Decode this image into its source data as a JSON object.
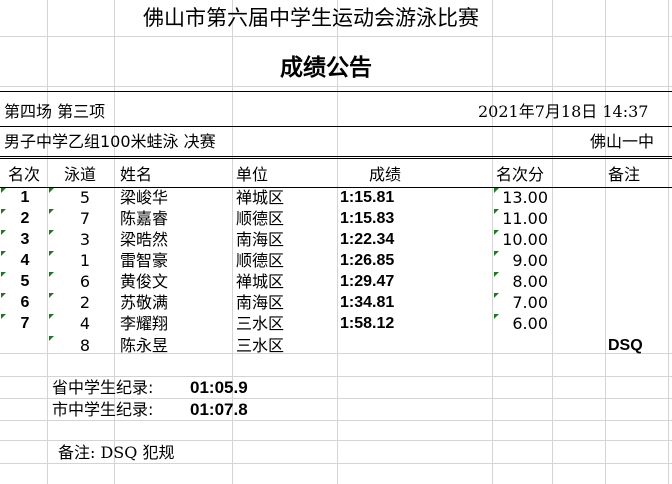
{
  "header": {
    "title": "佛山市第六届中学生运动会游泳比赛",
    "subtitle": "成绩公告"
  },
  "session": {
    "event_info": "第四场  第三项",
    "datetime": "2021年7月18日  14:37",
    "event_name": "男子中学乙组100米蛙泳  决赛",
    "venue": "佛山一中"
  },
  "table": {
    "columns": [
      "名次",
      "泳道",
      "姓名",
      "单位",
      "成绩",
      "名次分",
      "备注"
    ],
    "rows": [
      {
        "rank": "1",
        "lane": "5",
        "name": "梁峻华",
        "unit": "禅城区",
        "result": "1:15.81",
        "points": "13.00",
        "note": ""
      },
      {
        "rank": "2",
        "lane": "7",
        "name": "陈嘉睿",
        "unit": "顺德区",
        "result": "1:15.83",
        "points": "11.00",
        "note": ""
      },
      {
        "rank": "3",
        "lane": "3",
        "name": "梁晧然",
        "unit": "南海区",
        "result": "1:22.34",
        "points": "10.00",
        "note": ""
      },
      {
        "rank": "4",
        "lane": "1",
        "name": "雷智豪",
        "unit": "顺德区",
        "result": "1:26.85",
        "points": "9.00",
        "note": ""
      },
      {
        "rank": "5",
        "lane": "6",
        "name": "黄俊文",
        "unit": "禅城区",
        "result": "1:29.47",
        "points": "8.00",
        "note": ""
      },
      {
        "rank": "6",
        "lane": "2",
        "name": "苏敬满",
        "unit": "南海区",
        "result": "1:34.81",
        "points": "7.00",
        "note": ""
      },
      {
        "rank": "7",
        "lane": "4",
        "name": "李耀翔",
        "unit": "三水区",
        "result": "1:58.12",
        "points": "6.00",
        "note": ""
      },
      {
        "rank": "",
        "lane": "8",
        "name": "陈永昱",
        "unit": "三水区",
        "result": "",
        "points": "",
        "note": "DSQ"
      }
    ]
  },
  "records": {
    "provincial_label": "省中学生纪录:",
    "provincial_value": "01:05.9",
    "city_label": "市中学生纪录:",
    "city_value": "01:07.8"
  },
  "footnote": "备注:  DSQ 犯规",
  "colors": {
    "grid": "#d4d4d4",
    "marker": "#1e7a1e"
  }
}
